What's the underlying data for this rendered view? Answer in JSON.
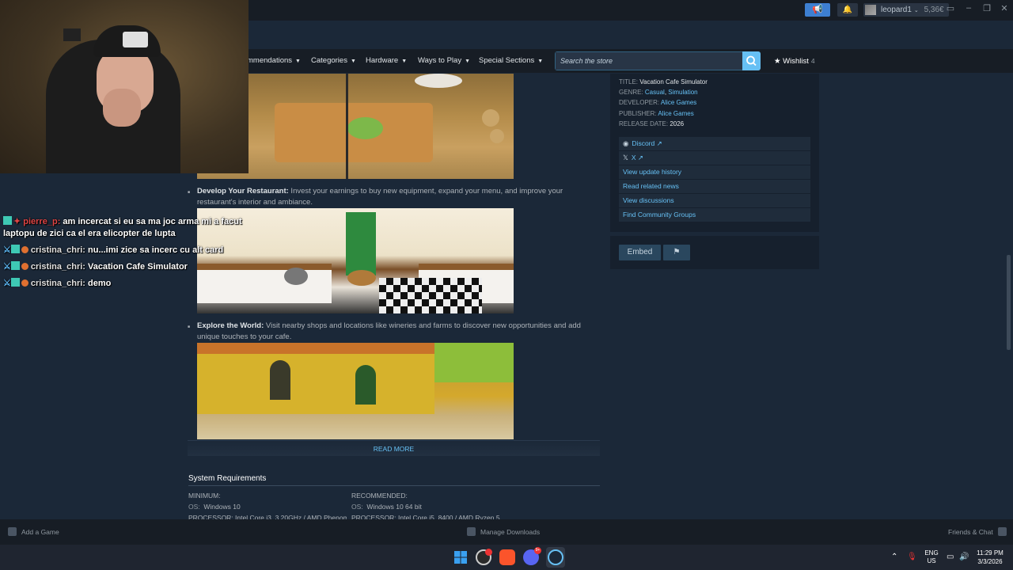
{
  "titlebar": {
    "username": "leopard1",
    "balance": "5,36€",
    "announce_icon": "megaphone-icon",
    "bell_icon": "bell-icon"
  },
  "nav": {
    "items": [
      "mmendations",
      "Categories",
      "Hardware",
      "Ways to Play",
      "Special Sections"
    ],
    "search_placeholder": "Search the store",
    "wishlist_label": "Wishlist",
    "wishlist_count": "4"
  },
  "content": {
    "bullets": [
      {
        "title": "Develop Your Restaurant:",
        "text": " Invest your earnings to buy new equipment, expand your menu, and improve your restaurant's interior and ambiance."
      },
      {
        "title": "Explore the World:",
        "text": " Visit nearby shops and locations like wineries and farms to discover new opportunities and add unique touches to your cafe."
      }
    ],
    "read_more": "READ MORE",
    "sysreq_title": "System Requirements",
    "minimum_label": "MINIMUM:",
    "recommended_label": "RECOMMENDED:",
    "min_os_label": "OS:",
    "min_os": "Windows 10",
    "rec_os_label": "OS:",
    "rec_os": "Windows 10 64 bit",
    "min_proc": "PROCESSOR: Intel Core i3, 3.20GHz / AMD Phenom",
    "rec_proc": "PROCESSOR: Intel Core i5, 8400 / AMD Ryzen 5"
  },
  "info": {
    "title_label": "TITLE:",
    "title": "Vacation Cafe Simulator",
    "genre_label": "GENRE:",
    "genre_1": "Casual",
    "genre_2": "Simulation",
    "developer_label": "DEVELOPER:",
    "developer": "Alice Games",
    "publisher_label": "PUBLISHER:",
    "publisher": "Alice Games",
    "release_label": "RELEASE DATE:",
    "release": "2026",
    "links": [
      "Discord",
      "X",
      "View update history",
      "Read related news",
      "View discussions",
      "Find Community Groups"
    ],
    "embed_label": "Embed"
  },
  "chat": {
    "messages": [
      {
        "user": "pierre_p:",
        "text": "am incercat si eu sa ma joc arma mi a facut laptopu de zici ca el era elicopter de lupta"
      },
      {
        "user": "cristina_chri:",
        "text": "nu...imi zice sa incerc cu alt card"
      },
      {
        "user": "cristina_chri:",
        "text": "Vacation Cafe Simulator"
      },
      {
        "user": "cristina_chri:",
        "text": "demo"
      }
    ]
  },
  "bottombar": {
    "add_game": "Add a Game",
    "manage_downloads": "Manage Downloads",
    "friends_chat": "Friends & Chat"
  },
  "taskbar": {
    "lang": "ENG",
    "region": "US",
    "time": "11:29 PM",
    "date": "3/3/2026",
    "discord_badge": "9+"
  },
  "colors": {
    "accent": "#66c0f4",
    "background": "#1b2838",
    "nav": "#171d25"
  }
}
